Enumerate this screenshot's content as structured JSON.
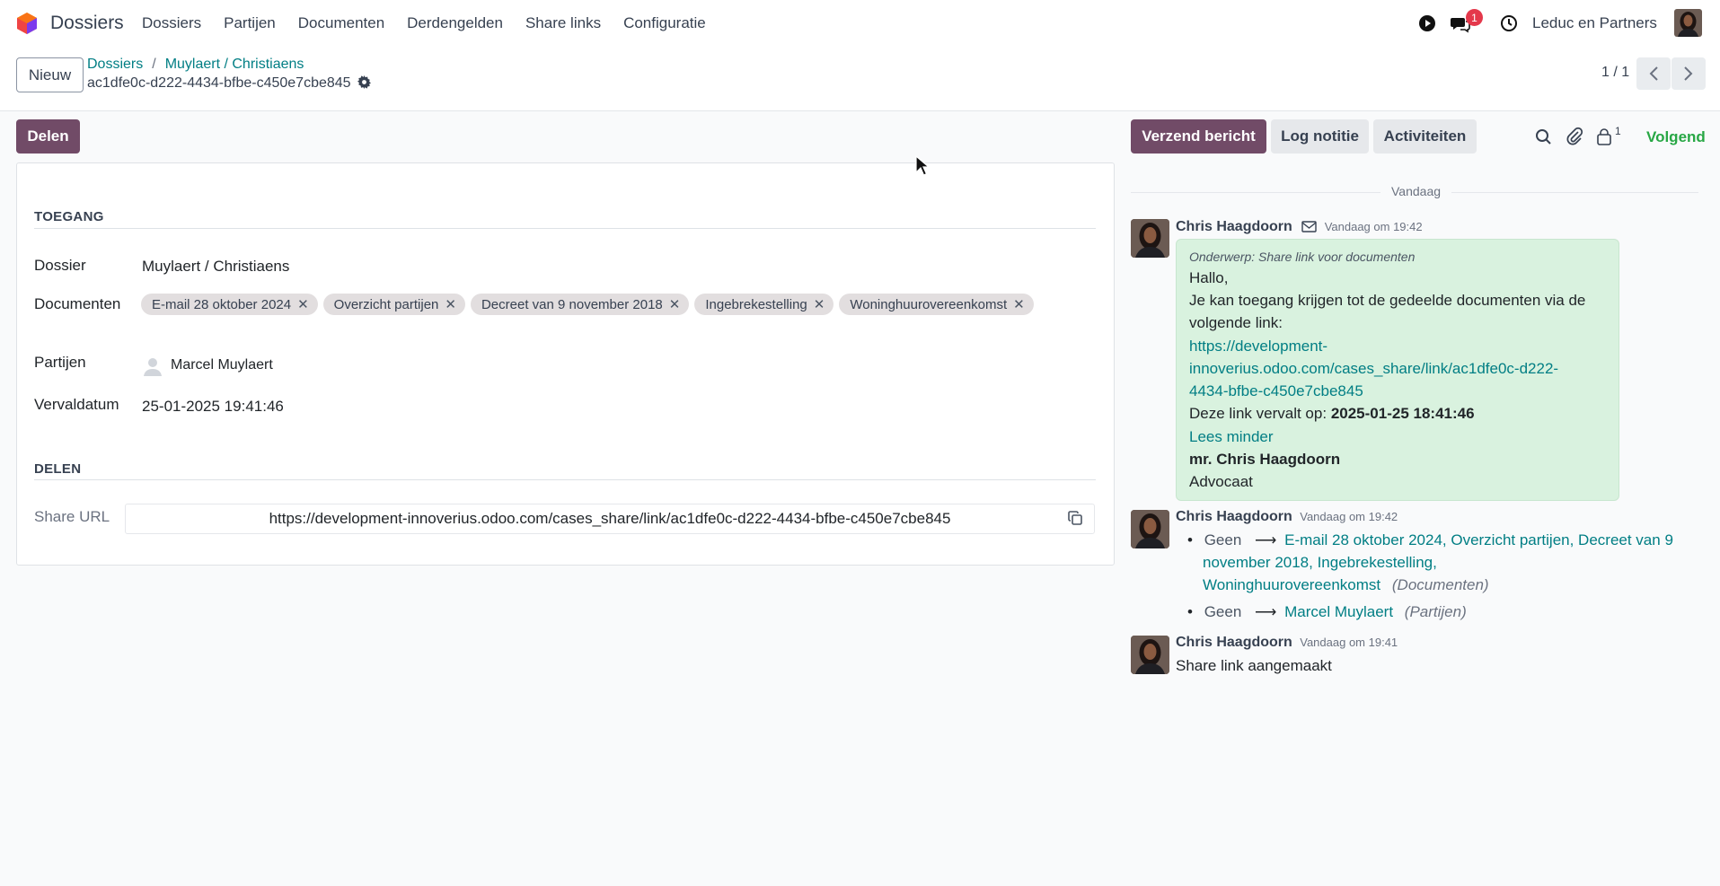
{
  "topbar": {
    "app_name": "Dossiers",
    "menu": [
      "Dossiers",
      "Partijen",
      "Documenten",
      "Derdengelden",
      "Share links",
      "Configuratie"
    ],
    "chat_badge": "1",
    "company": "Leduc en Partners"
  },
  "control": {
    "new_button": "Nieuw",
    "breadcrumb_root": "Dossiers",
    "breadcrumb_sep": "/",
    "breadcrumb_parent": "Muylaert / Christiaens",
    "record_name": "ac1dfe0c-d222-4434-bfbe-c450e7cbe845",
    "pager": "1 / 1"
  },
  "actions": {
    "share_button": "Delen",
    "send_message": "Verzend bericht",
    "log_note": "Log notitie",
    "activities": "Activiteiten",
    "followers_count": "1",
    "follow": "Volgend"
  },
  "form": {
    "section_access": "TOEGANG",
    "dossier_label": "Dossier",
    "dossier_value": "Muylaert / Christiaens",
    "documents_label": "Documenten",
    "documents": [
      "E-mail 28 oktober 2024",
      "Overzicht partijen",
      "Decreet van 9 november 2018",
      "Ingebrekestelling",
      "Woninghuurovereenkomst"
    ],
    "parties_label": "Partijen",
    "parties_value": "Marcel Muylaert",
    "expiry_label": "Vervaldatum",
    "expiry_value": "25-01-2025 19:41:46",
    "section_share": "DELEN",
    "share_url_label": "Share URL",
    "share_url_value": "https://development-innoverius.odoo.com/cases_share/link/ac1dfe0c-d222-4434-bfbe-c450e7cbe845"
  },
  "chatter": {
    "day_separator": "Vandaag",
    "messages": [
      {
        "author": "Chris Haagdoorn",
        "time": "Vandaag om 19:42",
        "subject": "Onderwerp: Share link voor documenten",
        "lines": [
          "Hallo,",
          "Je kan toegang krijgen tot de gedeelde documenten via de",
          "volgende link:"
        ],
        "link_lines": [
          "https://development-",
          "innoverius.odoo.com/cases_share/link/ac1dfe0c-d222-",
          "4434-bfbe-c450e7cbe845"
        ],
        "expiry_prefix": "Deze link vervalt op:",
        "expiry_value": "2025-01-25 18:41:46",
        "read_less": "Lees minder",
        "signature_name": "mr. Chris Haagdoorn",
        "signature_title": "Advocaat"
      },
      {
        "author": "Chris Haagdoorn",
        "time": "Vandaag om 19:42",
        "tracking": [
          {
            "old": "Geen",
            "new_lines": [
              "E-mail 28 oktober 2024, Overzicht partijen, Decreet van 9",
              "november 2018, Ingebrekestelling,",
              "Woninghuurovereenkomst"
            ],
            "field": "(Documenten)"
          },
          {
            "old": "Geen",
            "new_lines": [
              "Marcel Muylaert"
            ],
            "field": "(Partijen)"
          }
        ]
      },
      {
        "author": "Chris Haagdoorn",
        "time": "Vandaag om 19:41",
        "body": "Share link aangemaakt"
      }
    ]
  },
  "colors": {
    "primary": "#714b67",
    "link": "#017e84",
    "message_bg": "#d9f2df",
    "follow": "#28a745",
    "badge": "#e4384b"
  }
}
